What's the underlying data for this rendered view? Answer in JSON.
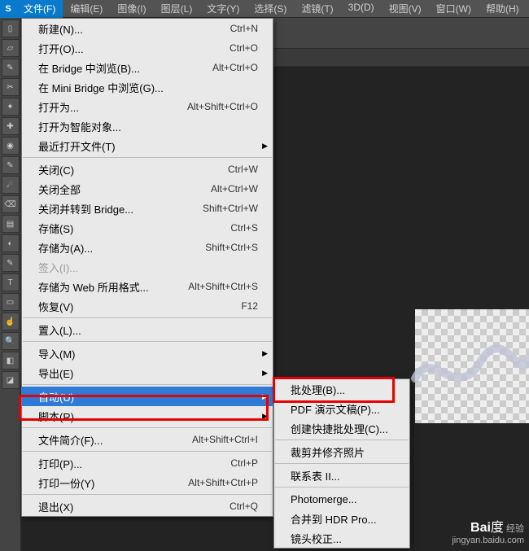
{
  "menubar": [
    "文件(F)",
    "编辑(E)",
    "图像(I)",
    "图层(L)",
    "文字(Y)",
    "选择(S)",
    "滤镜(T)",
    "3D(D)",
    "视图(V)",
    "窗口(W)",
    "帮助(H)"
  ],
  "ps_badge": "S",
  "path_text": "f63d960bb2b42306041b625d94d3018ced82d907",
  "file_menu": [
    {
      "label": "新建(N)...",
      "shortcut": "Ctrl+N"
    },
    {
      "label": "打开(O)...",
      "shortcut": "Ctrl+O"
    },
    {
      "label": "在 Bridge 中浏览(B)...",
      "shortcut": "Alt+Ctrl+O"
    },
    {
      "label": "在 Mini Bridge 中浏览(G)..."
    },
    {
      "label": "打开为...",
      "shortcut": "Alt+Shift+Ctrl+O"
    },
    {
      "label": "打开为智能对象..."
    },
    {
      "label": "最近打开文件(T)",
      "submenu": true
    },
    {
      "sep": true
    },
    {
      "label": "关闭(C)",
      "shortcut": "Ctrl+W"
    },
    {
      "label": "关闭全部",
      "shortcut": "Alt+Ctrl+W"
    },
    {
      "label": "关闭并转到 Bridge...",
      "shortcut": "Shift+Ctrl+W"
    },
    {
      "label": "存储(S)",
      "shortcut": "Ctrl+S"
    },
    {
      "label": "存储为(A)...",
      "shortcut": "Shift+Ctrl+S"
    },
    {
      "label": "签入(I)...",
      "disabled": true
    },
    {
      "label": "存储为 Web 所用格式...",
      "shortcut": "Alt+Shift+Ctrl+S"
    },
    {
      "label": "恢复(V)",
      "shortcut": "F12"
    },
    {
      "sep": true
    },
    {
      "label": "置入(L)..."
    },
    {
      "sep": true
    },
    {
      "label": "导入(M)",
      "submenu": true
    },
    {
      "label": "导出(E)",
      "submenu": true
    },
    {
      "sep": true
    },
    {
      "label": "自动(U)",
      "submenu": true,
      "highlight": true
    },
    {
      "label": "脚本(R)",
      "submenu": true
    },
    {
      "sep": true
    },
    {
      "label": "文件简介(F)...",
      "shortcut": "Alt+Shift+Ctrl+I"
    },
    {
      "sep": true
    },
    {
      "label": "打印(P)...",
      "shortcut": "Ctrl+P"
    },
    {
      "label": "打印一份(Y)",
      "shortcut": "Alt+Shift+Ctrl+P"
    },
    {
      "sep": true
    },
    {
      "label": "退出(X)",
      "shortcut": "Ctrl+Q"
    }
  ],
  "auto_submenu": [
    {
      "label": "批处理(B)..."
    },
    {
      "label": "PDF 演示文稿(P)..."
    },
    {
      "label": "创建快捷批处理(C)..."
    },
    {
      "sep": true
    },
    {
      "label": "裁剪并修齐照片"
    },
    {
      "sep": true
    },
    {
      "label": "联系表 II..."
    },
    {
      "sep": true
    },
    {
      "label": "Photomerge..."
    },
    {
      "label": "合并到 HDR Pro..."
    },
    {
      "label": "镜头校正..."
    }
  ],
  "watermark": {
    "brand": "Bai",
    "brand2": "经验",
    "url": "jingyan.baidu.com"
  }
}
